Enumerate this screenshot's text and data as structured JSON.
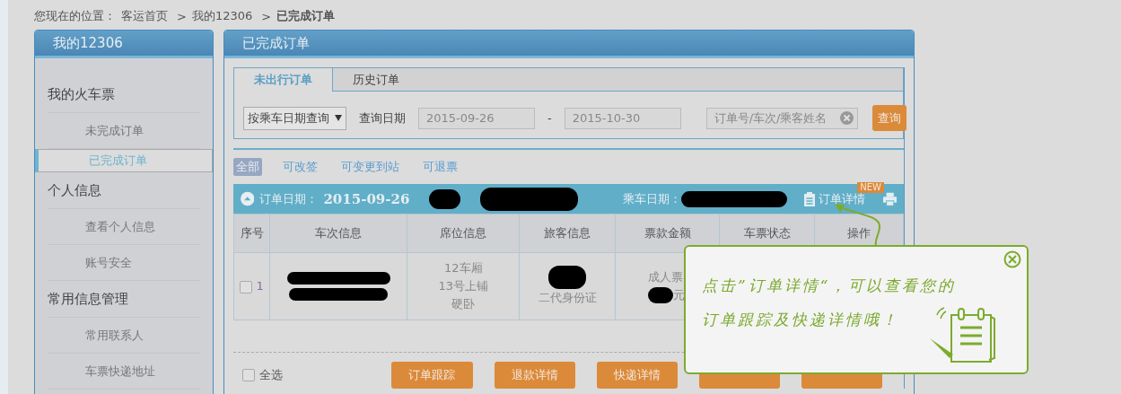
{
  "breadcrumb": {
    "prefix": "您现在的位置：",
    "items": [
      {
        "label": "客运首页",
        "current": false
      },
      {
        "sep": ">",
        "label": "我的12306",
        "current": false
      },
      {
        "sep": ">",
        "label": "已完成订单",
        "current": true
      }
    ]
  },
  "sidebar": {
    "title": "我的12306",
    "groups": [
      {
        "title": "我的火车票",
        "items": [
          {
            "label": "未完成订单",
            "selected": false
          },
          {
            "label": "已完成订单",
            "selected": true
          }
        ]
      },
      {
        "title": "个人信息",
        "items": [
          {
            "label": "查看个人信息",
            "selected": false
          },
          {
            "label": "账号安全",
            "selected": false
          }
        ]
      },
      {
        "title": "常用信息管理",
        "items": [
          {
            "label": "常用联系人",
            "selected": false
          },
          {
            "label": "车票快递地址",
            "selected": false
          }
        ]
      }
    ]
  },
  "main": {
    "title": "已完成订单",
    "tabs": [
      {
        "label": "未出行订单",
        "selected": true
      },
      {
        "label": "历史订单",
        "selected": false
      }
    ],
    "query": {
      "mode": "按乘车日期查询",
      "date_label": "查询日期",
      "date_from": "2015-09-26",
      "separator": "-",
      "date_to": "2015-10-30",
      "search_placeholder": "订单号/车次/乘客姓名",
      "search_button": "查询"
    },
    "filters": [
      {
        "label": "全部",
        "selected": true
      },
      {
        "label": "可改签",
        "selected": false
      },
      {
        "label": "可变更到站",
        "selected": false
      },
      {
        "label": "可退票",
        "selected": false
      }
    ],
    "order": {
      "order_date_label": "订单日期：",
      "order_date": "2015-09-26",
      "travel_date_label": "乘车日期：",
      "details_link": "订单详情",
      "badge": "NEW",
      "columns": [
        "序号",
        "车次信息",
        "席位信息",
        "旅客信息",
        "票款金额",
        "车票状态",
        "操作"
      ],
      "rows": [
        {
          "checked": false,
          "index": "1",
          "seat": [
            "12车厢",
            "13号上铺",
            "硬卧"
          ],
          "id_type": "二代身份证",
          "ticket_type": "成人票",
          "amount_suffix": "元"
        }
      ],
      "select_all": {
        "label": "全选",
        "checked": false
      },
      "buttons": [
        "订单跟踪",
        "退款详情",
        "快递详情"
      ]
    }
  },
  "tip": {
    "lines": [
      "点击”订单详情“，可以查看您的",
      "订单跟踪及快递详情哦！"
    ]
  }
}
